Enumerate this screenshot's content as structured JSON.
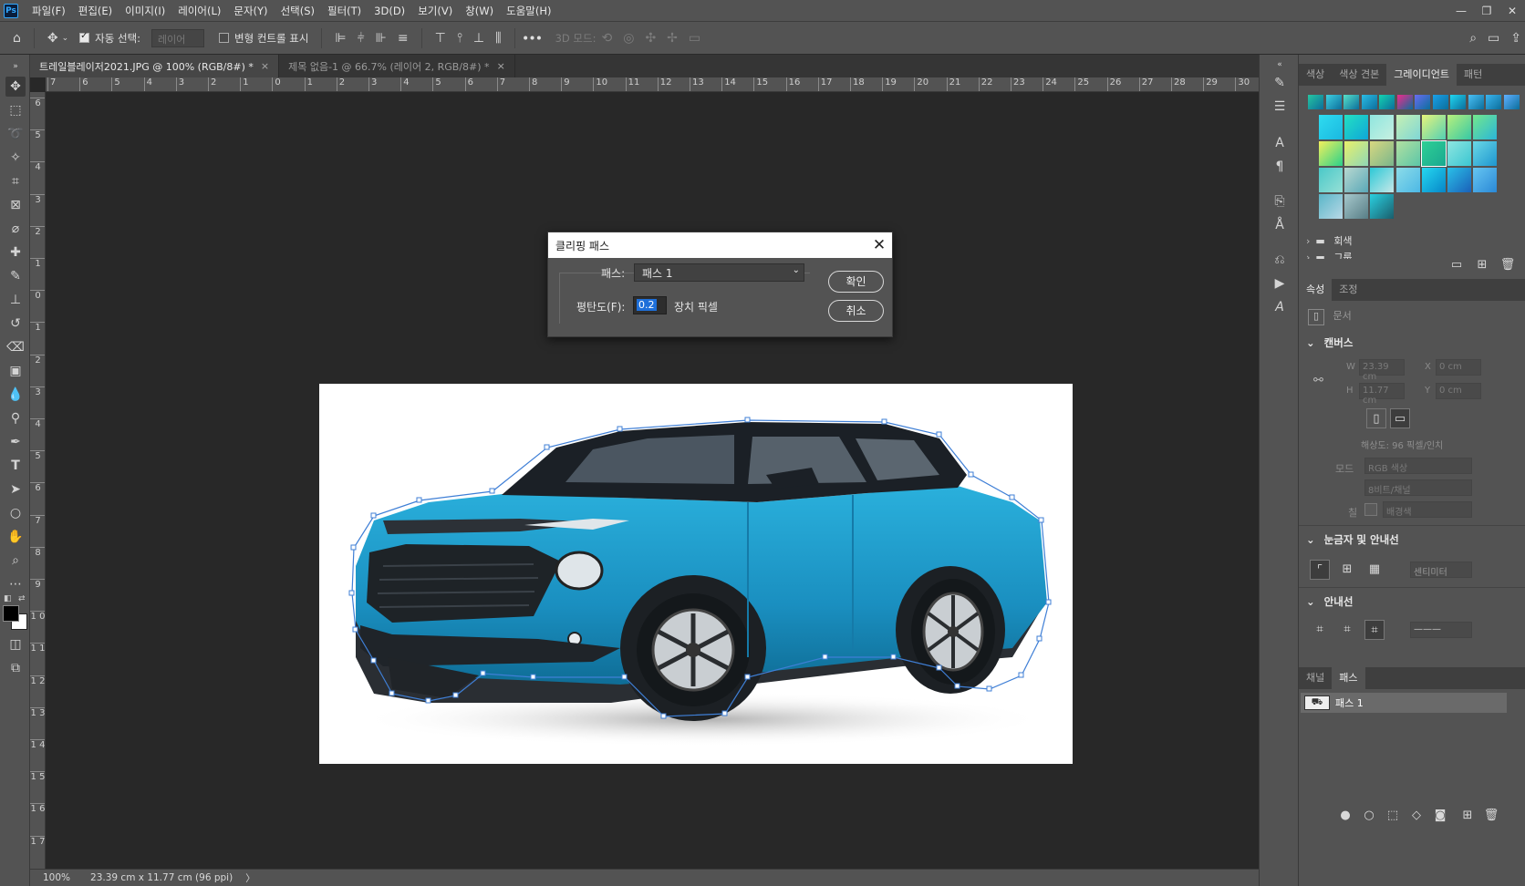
{
  "menu": {
    "logo": "Ps",
    "items": [
      "파일(F)",
      "편집(E)",
      "이미지(I)",
      "레이어(L)",
      "문자(Y)",
      "선택(S)",
      "필터(T)",
      "3D(D)",
      "보기(V)",
      "창(W)",
      "도움말(H)"
    ],
    "window_controls": [
      "—",
      "❐",
      "✕"
    ]
  },
  "options": {
    "auto_select_label": "자동 선택:",
    "auto_select_target": "레이어",
    "transform_controls_label": "변형 컨트롤 표시",
    "three_d_mode_label": "3D 모드:",
    "more_label": "•••"
  },
  "tabs": [
    {
      "label": "트레일블레이저2021.JPG @ 100% (RGB/8#) *",
      "close": "×"
    },
    {
      "label": "제목 없음-1 @ 66.7% (레이어 2, RGB/8#) *",
      "close": "×"
    }
  ],
  "ruler": {
    "top_ticks": [
      "7",
      "6",
      "5",
      "4",
      "3",
      "2",
      "1",
      "0",
      "1",
      "2",
      "3",
      "4",
      "5",
      "6",
      "7",
      "8",
      "9",
      "10",
      "11",
      "12",
      "13",
      "14",
      "15",
      "16",
      "17",
      "18",
      "19",
      "20",
      "21",
      "22",
      "23",
      "24",
      "25",
      "26",
      "27",
      "28",
      "29",
      "30"
    ],
    "left_ticks": [
      "6",
      "5",
      "4",
      "3",
      "2",
      "1",
      "0",
      "1",
      "2",
      "3",
      "4",
      "5",
      "6",
      "7",
      "8",
      "9",
      "1 0",
      "1 1",
      "1 2",
      "1 3",
      "1 4",
      "1 5",
      "1 6",
      "1 7"
    ]
  },
  "status": {
    "zoom": "100%",
    "doc_info": "23.39 cm x 11.77 cm (96 ppi)",
    "arrow": "〉"
  },
  "dialog": {
    "title": "클리핑 패스",
    "close": "✕",
    "path_label": "패스:",
    "path_value": "패스 1",
    "flatness_label": "평탄도(F):",
    "flatness_value": "0.2",
    "unit_label": "장치 픽셀",
    "ok_label": "확인",
    "cancel_label": "취소"
  },
  "right_panels": {
    "top_tabs": [
      "색상",
      "색상 견본",
      "그레이디언트",
      "패턴"
    ],
    "active_top_tab": "그레이디언트",
    "gradient_folders": [
      "회색",
      "그룹"
    ],
    "prop_tabs": [
      "속성",
      "조정"
    ],
    "doc_label": "문서",
    "canvas_section": "캔버스",
    "width_label": "W",
    "width_value": "23.39 cm",
    "height_label": "H",
    "height_value": "11.77 cm",
    "x_label": "X",
    "x_value": "0 cm",
    "y_label": "Y",
    "y_value": "0 cm",
    "resolution": "해상도: 96 픽셀/인치",
    "mode_label": "모드",
    "mode_value": "RGB 색상",
    "bit_value": "8비트/채널",
    "fill_label": "칠",
    "fill_value": "배경색",
    "rulers_section": "눈금자 및 안내선",
    "units_value": "센티미터",
    "guides_section": "안내선",
    "bottom_tabs": [
      "채널",
      "패스"
    ],
    "active_bottom_tab": "패스",
    "path_item": "패스 1"
  },
  "colors": {
    "accent": "#1e6fd9",
    "car_body": "#1e95c4",
    "path_line": "#3f7fd6"
  }
}
